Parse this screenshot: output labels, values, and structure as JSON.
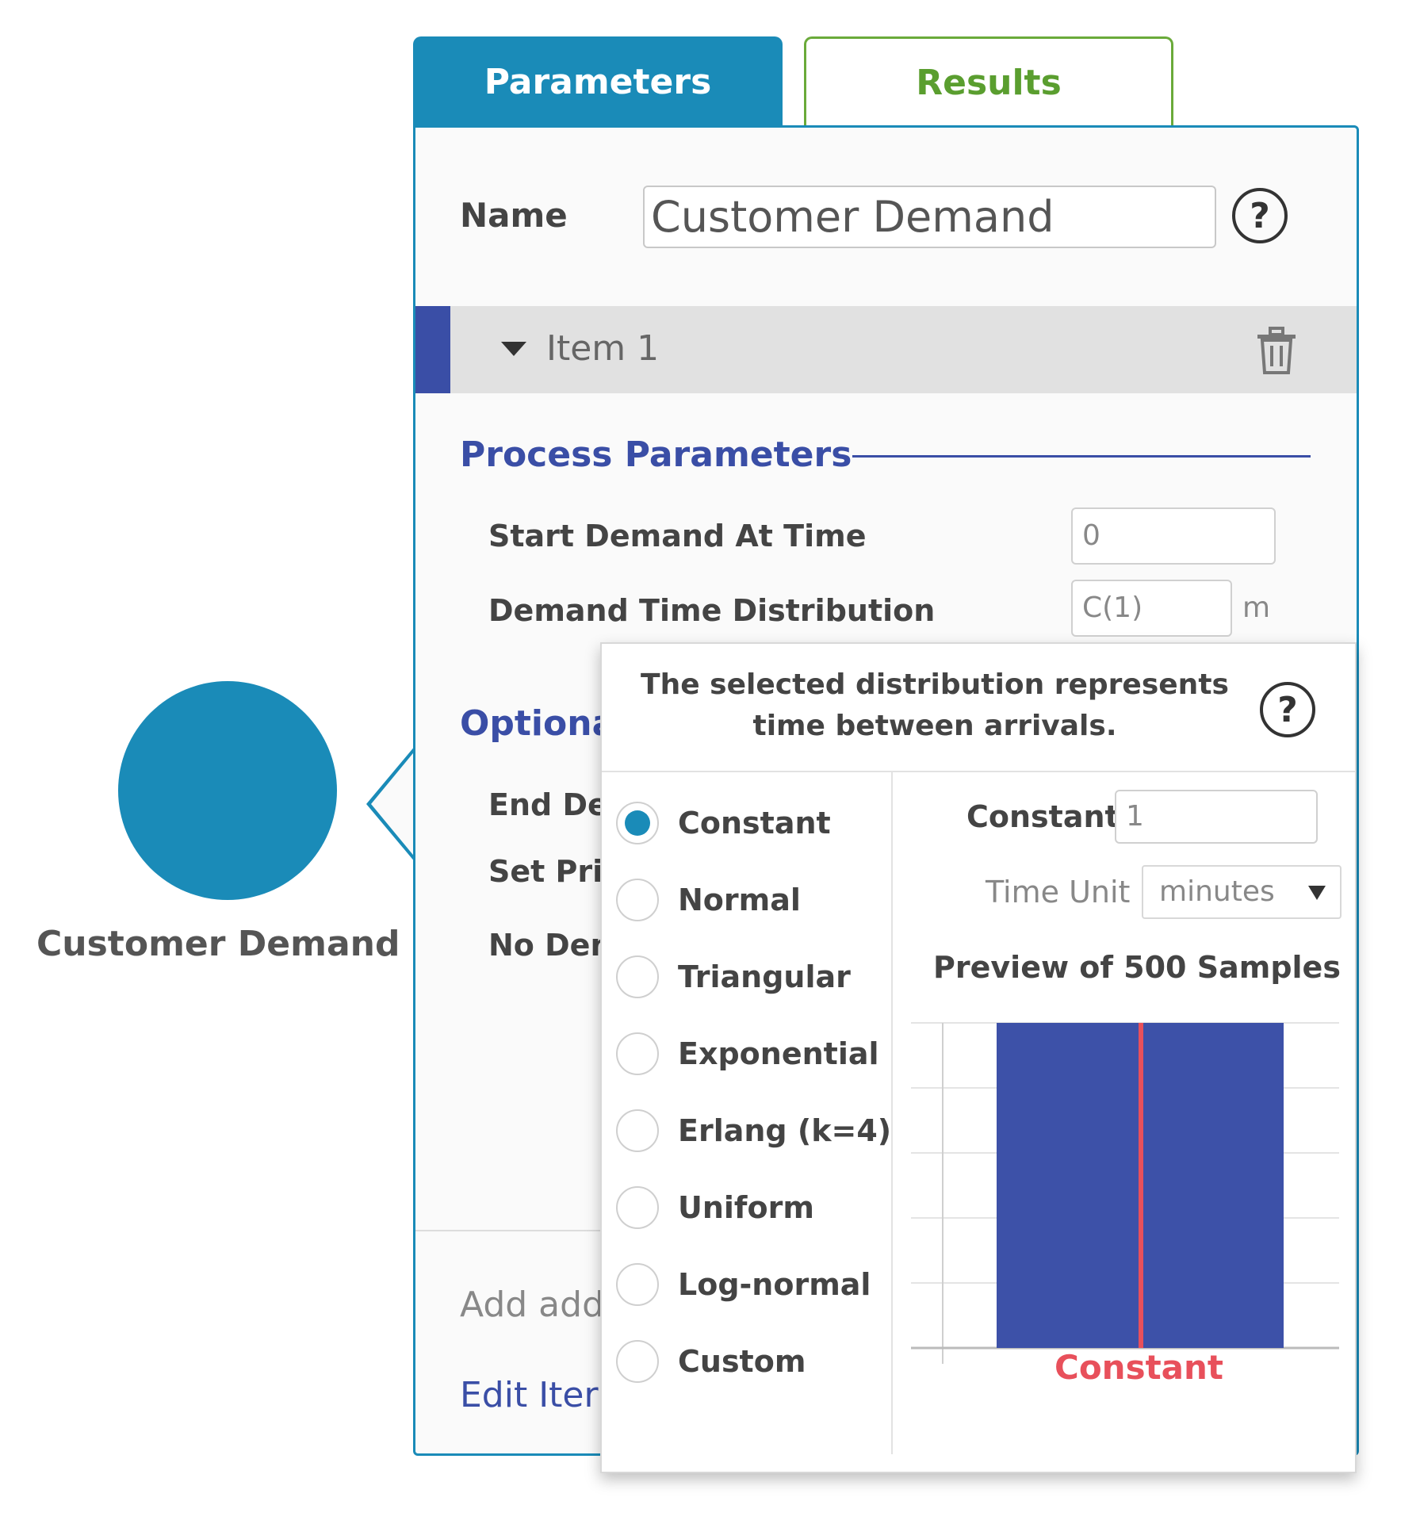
{
  "canvas": {
    "node_label": "Customer Demand"
  },
  "tabs": {
    "parameters": "Parameters",
    "results": "Results"
  },
  "panel": {
    "name_label": "Name",
    "name_value": "Customer Demand",
    "help_glyph": "?",
    "item_title": "Item 1",
    "process_section": "Process Parameters",
    "start_label": "Start Demand At Time",
    "start_value": "0",
    "dist_label": "Demand Time Distribution",
    "dist_value": "C(1)",
    "dist_unit": "m",
    "optional_section_partial": "Optiona",
    "row_end_partial": "End De",
    "row_price_partial": "Set Pric",
    "row_nodemand_partial": "No Den",
    "add_partial": "Add add",
    "edit_partial": "Edit Iter"
  },
  "popup": {
    "header_text": "The selected distribution represents time between arrivals.",
    "distributions": [
      {
        "label": "Constant",
        "selected": true
      },
      {
        "label": "Normal",
        "selected": false
      },
      {
        "label": "Triangular",
        "selected": false
      },
      {
        "label": "Exponential",
        "selected": false
      },
      {
        "label": "Erlang (k=4)",
        "selected": false
      },
      {
        "label": "Uniform",
        "selected": false
      },
      {
        "label": "Log-normal",
        "selected": false
      },
      {
        "label": "Custom",
        "selected": false
      }
    ],
    "constant_label": "Constant",
    "constant_value": "1",
    "time_unit_label": "Time Unit",
    "time_unit_value": "minutes",
    "preview_title": "Preview of 500 Samples"
  },
  "chart_data": {
    "type": "bar",
    "title": "Preview of 500 Samples",
    "categories": [
      "Constant"
    ],
    "values": [
      500
    ],
    "marker_label": "Constant",
    "marker_value": 1,
    "grid": true,
    "colors": {
      "bar": "#3d51a8",
      "marker": "#e8505b"
    }
  },
  "colors": {
    "primary": "#1a8bb8",
    "results_green": "#5a9e2f",
    "section_blue": "#3a4ea6"
  },
  "icons": {
    "help": "help-icon",
    "trash": "trash-icon",
    "caret": "caret-down-icon",
    "select_arrow": "chevron-down-icon"
  }
}
